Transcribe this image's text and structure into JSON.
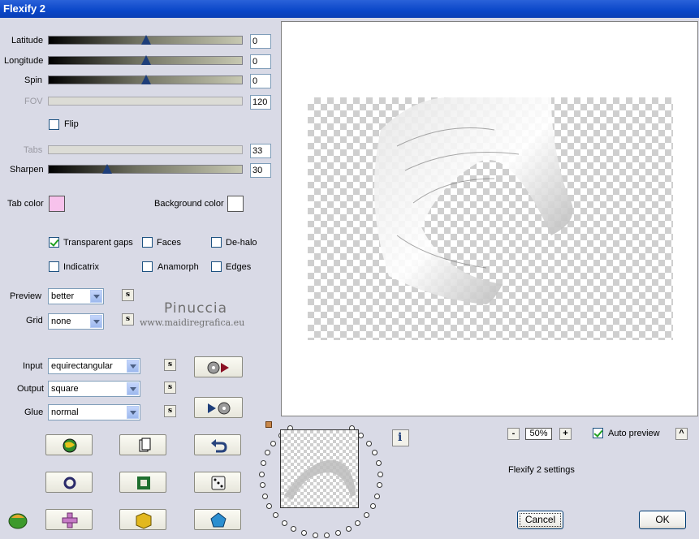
{
  "window": {
    "title": "Flexify 2"
  },
  "sliders": [
    {
      "label": "Latitude",
      "value": "0",
      "enabled": true,
      "level": 0.5
    },
    {
      "label": "Longitude",
      "value": "0",
      "enabled": true,
      "level": 0.5
    },
    {
      "label": "Spin",
      "value": "0",
      "enabled": true,
      "level": 0.5
    },
    {
      "label": "FOV",
      "value": "120",
      "enabled": false
    },
    {
      "label": "Tabs",
      "value": "33",
      "enabled": false
    },
    {
      "label": "Sharpen",
      "value": "30",
      "enabled": true,
      "level": 0.3
    }
  ],
  "flip": {
    "label": "Flip",
    "checked": false
  },
  "colors": {
    "tab_label": "Tab color",
    "tab_value": "#f7c2ec",
    "background_label": "Background color",
    "background_value": "#ffffff"
  },
  "options": {
    "transparent_gaps": {
      "label": "Transparent gaps",
      "checked": true
    },
    "faces": {
      "label": "Faces",
      "checked": false
    },
    "de_halo": {
      "label": "De-halo",
      "checked": false
    },
    "indicatrix": {
      "label": "Indicatrix",
      "checked": false
    },
    "anamorph": {
      "label": "Anamorph",
      "checked": false
    },
    "edges": {
      "label": "Edges",
      "checked": false
    }
  },
  "preview_quality": {
    "label": "Preview",
    "value": "better"
  },
  "grid": {
    "label": "Grid",
    "value": "none"
  },
  "input": {
    "label": "Input",
    "value": "equirectangular"
  },
  "output": {
    "label": "Output",
    "value": "square"
  },
  "glue": {
    "label": "Glue",
    "value": "normal"
  },
  "s_button": "s",
  "watermark": {
    "name": "Pinuccia",
    "site": "www.maidiregrafica.eu"
  },
  "zoom": {
    "minus": "-",
    "value": "50%",
    "plus": "+"
  },
  "auto_preview": {
    "label": "Auto preview",
    "checked": true
  },
  "caret_button": "^",
  "info_button": "i",
  "settings_name": "Flexify 2 settings",
  "footer": {
    "cancel": "Cancel",
    "ok": "OK"
  }
}
